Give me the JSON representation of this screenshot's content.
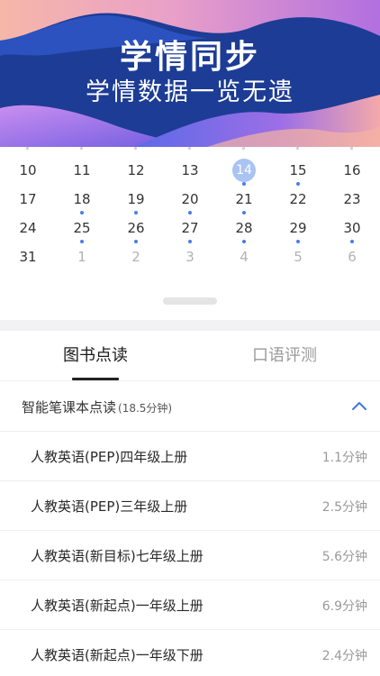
{
  "banner": {
    "title": "学情同步",
    "subtitle": "学情数据一览无遗"
  },
  "calendar": {
    "selected_day": "14",
    "weeks": [
      [
        {
          "day": "10",
          "dim": false,
          "dot": false,
          "selected": false
        },
        {
          "day": "11",
          "dim": false,
          "dot": false,
          "selected": false
        },
        {
          "day": "12",
          "dim": false,
          "dot": false,
          "selected": false
        },
        {
          "day": "13",
          "dim": false,
          "dot": false,
          "selected": false
        },
        {
          "day": "14",
          "dim": false,
          "dot": true,
          "selected": true
        },
        {
          "day": "15",
          "dim": false,
          "dot": true,
          "selected": false
        },
        {
          "day": "16",
          "dim": false,
          "dot": false,
          "selected": false
        }
      ],
      [
        {
          "day": "17",
          "dim": false,
          "dot": false,
          "selected": false
        },
        {
          "day": "18",
          "dim": false,
          "dot": true,
          "selected": false
        },
        {
          "day": "19",
          "dim": false,
          "dot": true,
          "selected": false
        },
        {
          "day": "20",
          "dim": false,
          "dot": true,
          "selected": false
        },
        {
          "day": "21",
          "dim": false,
          "dot": true,
          "selected": false
        },
        {
          "day": "22",
          "dim": false,
          "dot": false,
          "selected": false
        },
        {
          "day": "23",
          "dim": false,
          "dot": false,
          "selected": false
        }
      ],
      [
        {
          "day": "24",
          "dim": false,
          "dot": false,
          "selected": false
        },
        {
          "day": "25",
          "dim": false,
          "dot": true,
          "selected": false
        },
        {
          "day": "26",
          "dim": false,
          "dot": true,
          "selected": false
        },
        {
          "day": "27",
          "dim": false,
          "dot": true,
          "selected": false
        },
        {
          "day": "28",
          "dim": false,
          "dot": true,
          "selected": false
        },
        {
          "day": "29",
          "dim": false,
          "dot": true,
          "selected": false
        },
        {
          "day": "30",
          "dim": false,
          "dot": true,
          "selected": false
        }
      ],
      [
        {
          "day": "31",
          "dim": false,
          "dot": false,
          "selected": false
        },
        {
          "day": "1",
          "dim": true,
          "dot": false,
          "selected": false
        },
        {
          "day": "2",
          "dim": true,
          "dot": false,
          "selected": false
        },
        {
          "day": "3",
          "dim": true,
          "dot": false,
          "selected": false
        },
        {
          "day": "4",
          "dim": true,
          "dot": false,
          "selected": false
        },
        {
          "day": "5",
          "dim": true,
          "dot": false,
          "selected": false
        },
        {
          "day": "6",
          "dim": true,
          "dot": false,
          "selected": false
        }
      ]
    ]
  },
  "tabs": [
    {
      "label": "图书点读",
      "active": true
    },
    {
      "label": "口语评测",
      "active": false
    }
  ],
  "summary": {
    "title": "智能笔课本点读",
    "duration": "(18.5分钟)",
    "expanded_icon": "chevron-up-icon"
  },
  "books": [
    {
      "title": "人教英语(PEP)四年级上册",
      "time": "1.1分钟"
    },
    {
      "title": "人教英语(PEP)三年级上册",
      "time": "2.5分钟"
    },
    {
      "title": "人教英语(新目标)七年级上册",
      "time": "5.6分钟"
    },
    {
      "title": "人教英语(新起点)一年级上册",
      "time": "6.9分钟"
    },
    {
      "title": "人教英语(新起点)一年级下册",
      "time": "2.4分钟"
    }
  ],
  "colors": {
    "banner_bg": "#1d3c95",
    "accent_blue": "#4a7de6",
    "selected_day_bg": "#a9c4f2",
    "divider": "#eeeeee"
  }
}
